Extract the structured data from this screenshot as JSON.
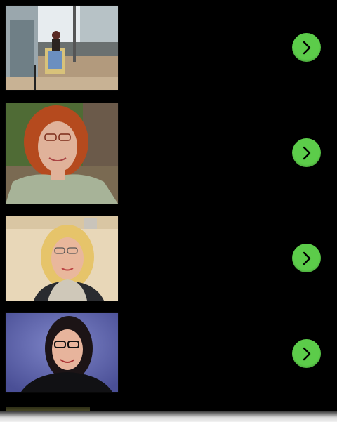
{
  "people_list": {
    "items": [
      {
        "photo": "building-entrance-photo",
        "action_icon": "chevron-right-icon"
      },
      {
        "photo": "red-haired-woman-photo",
        "action_icon": "chevron-right-icon"
      },
      {
        "photo": "blonde-woman-photo",
        "action_icon": "chevron-right-icon"
      },
      {
        "photo": "dark-haired-woman-photo",
        "action_icon": "chevron-right-icon"
      }
    ]
  },
  "colors": {
    "background": "#000000",
    "button": "#5ccc4a",
    "button_icon": "#000000"
  }
}
